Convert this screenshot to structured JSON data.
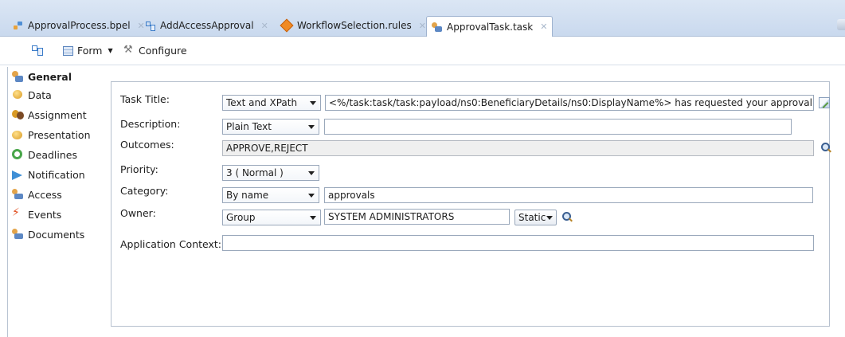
{
  "tabs": [
    {
      "label": "ApprovalProcess.bpel",
      "icon": "bpel-process-icon"
    },
    {
      "label": "AddAccessApproval",
      "icon": "workflow-icon"
    },
    {
      "label": "WorkflowSelection.rules",
      "icon": "rules-icon"
    },
    {
      "label": "ApprovalTask.task",
      "icon": "human-task-icon"
    }
  ],
  "toolbar": {
    "form_label": "Form",
    "configure_label": "Configure"
  },
  "nav": {
    "items": [
      {
        "label": "General",
        "icon": "human-task-icon"
      },
      {
        "label": "Data",
        "icon": "data-icon"
      },
      {
        "label": "Assignment",
        "icon": "assignment-icon"
      },
      {
        "label": "Presentation",
        "icon": "presentation-icon"
      },
      {
        "label": "Deadlines",
        "icon": "deadlines-icon"
      },
      {
        "label": "Notification",
        "icon": "notification-icon"
      },
      {
        "label": "Access",
        "icon": "access-icon"
      },
      {
        "label": "Events",
        "icon": "events-icon"
      },
      {
        "label": "Documents",
        "icon": "documents-icon"
      }
    ]
  },
  "form": {
    "task_title": {
      "label": "Task Title:",
      "mode": "Text and XPath",
      "value": "<%/task:task/task:payload/ns0:BeneficiaryDetails/ns0:DisplayName%> has requested your approval."
    },
    "description": {
      "label": "Description:",
      "mode": "Plain Text",
      "value": ""
    },
    "outcomes": {
      "label": "Outcomes:",
      "value": "APPROVE,REJECT"
    },
    "priority": {
      "label": "Priority:",
      "value": "3  ( Normal )"
    },
    "category": {
      "label": "Category:",
      "mode": "By name",
      "value": "approvals"
    },
    "owner": {
      "label": "Owner:",
      "mode": "Group",
      "value": "SYSTEM ADMINISTRATORS",
      "binding": "Static"
    },
    "application_context": {
      "label": "Application Context:",
      "value": ""
    }
  }
}
